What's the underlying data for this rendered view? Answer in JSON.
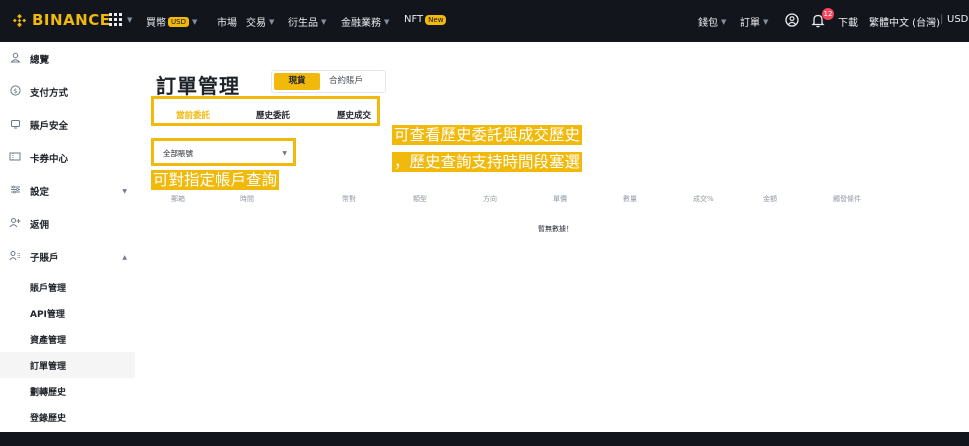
{
  "brand": {
    "name": "BINANCE",
    "color": "#f0b90b"
  },
  "topnav": {
    "items": [
      {
        "label": "買幣",
        "badge": "USD",
        "has_caret": true
      },
      {
        "label": "市場",
        "has_caret": false
      },
      {
        "label": "交易",
        "has_caret": true
      },
      {
        "label": "衍生品",
        "has_caret": true
      },
      {
        "label": "金融業務",
        "has_caret": true
      },
      {
        "label": "NFT",
        "badge": "New",
        "has_caret": false
      }
    ],
    "right": {
      "wallet": "錢包",
      "orders": "訂單",
      "notification_count": "12",
      "download": "下載",
      "language": "繁體中文 (台灣)",
      "divider": "|",
      "currency": "USD"
    }
  },
  "sidebar": {
    "items": [
      {
        "label": "總覽",
        "icon": "user-icon"
      },
      {
        "label": "支付方式",
        "icon": "dollar-circle-icon"
      },
      {
        "label": "賬戶安全",
        "icon": "shield-icon"
      },
      {
        "label": "卡券中心",
        "icon": "ticket-icon"
      },
      {
        "label": "設定",
        "icon": "sliders-icon",
        "arrow": "down"
      },
      {
        "label": "返佣",
        "icon": "add-user-icon"
      },
      {
        "label": "子賬戶",
        "icon": "users-icon",
        "arrow": "up"
      }
    ],
    "sub_items": [
      {
        "label": "賬戶管理",
        "active": false
      },
      {
        "label": "API管理",
        "active": false
      },
      {
        "label": "資產管理",
        "active": false
      },
      {
        "label": "訂單管理",
        "active": true
      },
      {
        "label": "劃轉歷史",
        "active": false
      },
      {
        "label": "登錄歷史",
        "active": false
      }
    ]
  },
  "main": {
    "title": "訂單管理",
    "account_tabs": [
      {
        "label": "現貨",
        "active": true
      },
      {
        "label": "合約賬戶",
        "active": false
      }
    ],
    "order_tabs": [
      {
        "label": "當前委託",
        "active": true
      },
      {
        "label": "歷史委託",
        "active": false
      },
      {
        "label": "歷史成交",
        "active": false
      }
    ],
    "account_select": {
      "value": "全部賬號"
    },
    "table": {
      "columns": [
        "郵箱",
        "時間",
        "幣對",
        "類型",
        "方向",
        "單價",
        "數量",
        "成交%",
        "金額",
        "觸發條件"
      ],
      "empty_text": "暫無數據！"
    }
  },
  "annotations": {
    "history_note_line1": "可查看歷史委託與成交歷史",
    "history_note_line2": "，歷史查詢支持時間段塞選",
    "account_note": "可對指定帳戶查詢"
  }
}
